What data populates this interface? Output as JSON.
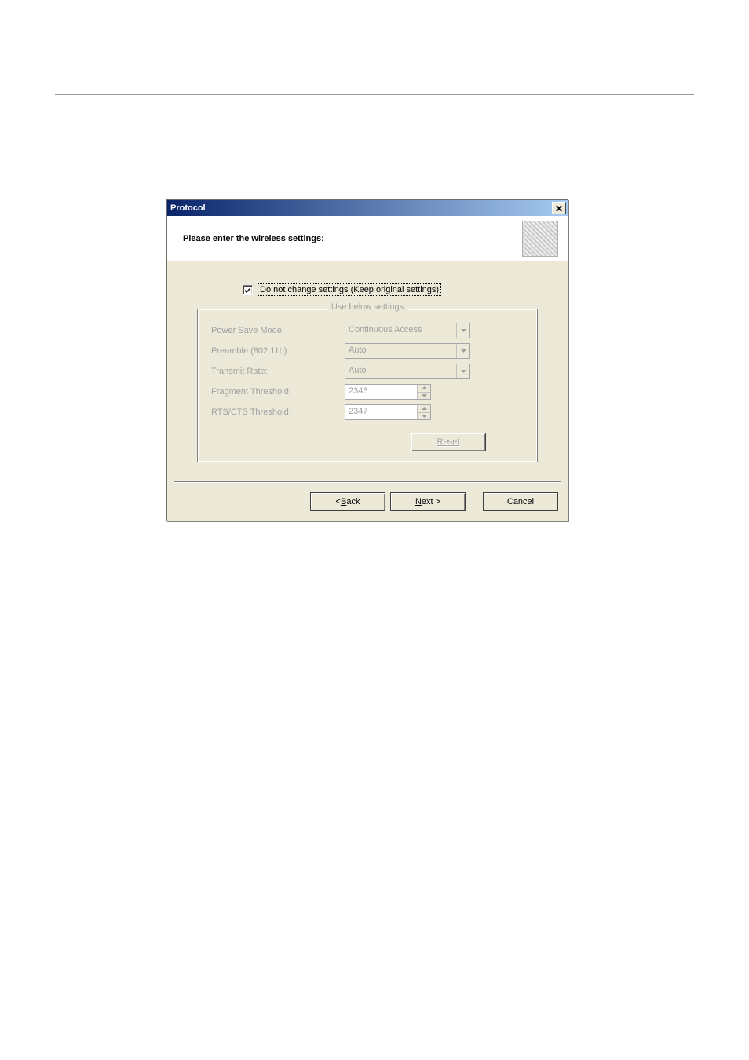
{
  "dialog": {
    "title": "Protocol",
    "heading": "Please enter the wireless settings:",
    "keep_original_label": "Do not change settings (Keep original settings)",
    "keep_original_checked": true,
    "group_legend": "Use below settings",
    "fields": {
      "power_save_mode": {
        "label": "Power Save Mode:",
        "value": "Continuous Access"
      },
      "preamble": {
        "label": "Preamble (802.11b):",
        "value": "Auto"
      },
      "transmit_rate": {
        "label": "Transmit Rate:",
        "value": "Auto"
      },
      "fragment_thresh": {
        "label": "Fragment Threshold:",
        "value": "2346"
      },
      "rts_cts_thresh": {
        "label": "RTS/CTS Threshold:",
        "value": "2347"
      }
    },
    "buttons": {
      "reset": "Reset",
      "back_prefix": "< ",
      "back_mnemonic": "B",
      "back_suffix": "ack",
      "next_mnemonic": "N",
      "next_suffix": "ext >",
      "cancel": "Cancel"
    }
  }
}
